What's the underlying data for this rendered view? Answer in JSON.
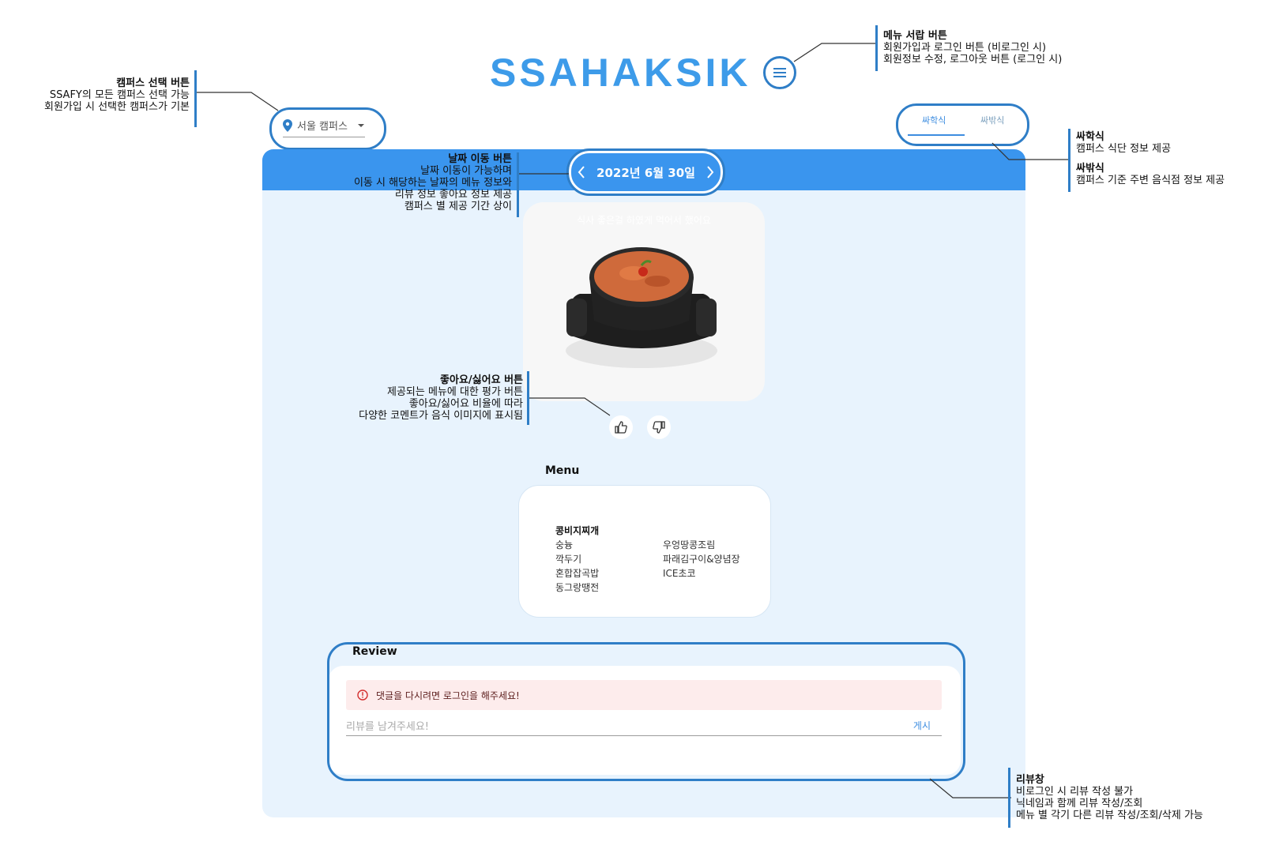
{
  "app": {
    "logo": "SSAHAKSIK"
  },
  "campus_select": {
    "value": "서울 캠퍼스"
  },
  "tabs": [
    {
      "label": "싸학식",
      "active": true
    },
    {
      "label": "싸밖식",
      "active": false
    }
  ],
  "date_nav": {
    "date": "2022년 6월 30일"
  },
  "food": {
    "overlay_text": "식사 좋은걸 하였게 먹어서 했어요",
    "image": "kimchi-stew-in-black-earthenware-pot"
  },
  "menu": {
    "title": "Menu",
    "main": "콩비지찌개",
    "left": [
      "숭늉",
      "깍두기",
      "혼합잡곡밥",
      "동그랑땡전"
    ],
    "right": [
      "우엉땅콩조림",
      "파래김구이&양념장",
      "ICE초코"
    ]
  },
  "review": {
    "title": "Review",
    "alert": "댓글을 다시려면 로그인을 해주세요!",
    "placeholder": "리뷰를 남겨주세요!",
    "post_label": "게시"
  },
  "annotations": {
    "menu_drawer": {
      "title": "메뉴 서랍 버튼",
      "lines": [
        "회원가입과 로그인 버튼 (비로그인 시)",
        "회원정보 수정, 로그아웃 버튼 (로그인 시)"
      ]
    },
    "campus": {
      "title": "캠퍼스 선택 버튼",
      "lines": [
        "SSAFY의 모든 캠퍼스 선택 가능",
        "회원가입 시 선택한 캠퍼스가 기본"
      ]
    },
    "ssahak": {
      "title": "싸학식",
      "lines": [
        "캠퍼스 식단 정보 제공"
      ]
    },
    "ssabak": {
      "title": "싸밖식",
      "lines": [
        "캠퍼스 기준 주변 음식점 정보 제공"
      ]
    },
    "date": {
      "title": "날짜 이동 버튼",
      "lines": [
        "날짜 이동이 가능하며",
        "이동 시 해당하는 날짜의 메뉴 정보와",
        "리뷰 정보 좋아요 정보 제공",
        "캠퍼스 별 제공 기간 상이"
      ]
    },
    "like": {
      "title": "좋아요/싫어요 버튼",
      "lines": [
        "제공되는 메뉴에 대한 평가 버튼",
        "좋아요/싫어요 비율에 따라",
        "다양한 코멘트가 음식 이미지에 표시됨"
      ]
    },
    "review": {
      "title": "리뷰창",
      "lines": [
        "비로그인 시 리뷰 작성 불가",
        "닉네임과 함께 리뷰 작성/조회",
        "메뉴 별 각기 다른 리뷰 작성/조회/삭제 가능"
      ]
    }
  },
  "colors": {
    "accent": "#3a95ee",
    "panel_bg": "#e8f3fd",
    "annotation_blue": "#2f7ec7",
    "alert_bg": "#fdecec"
  }
}
